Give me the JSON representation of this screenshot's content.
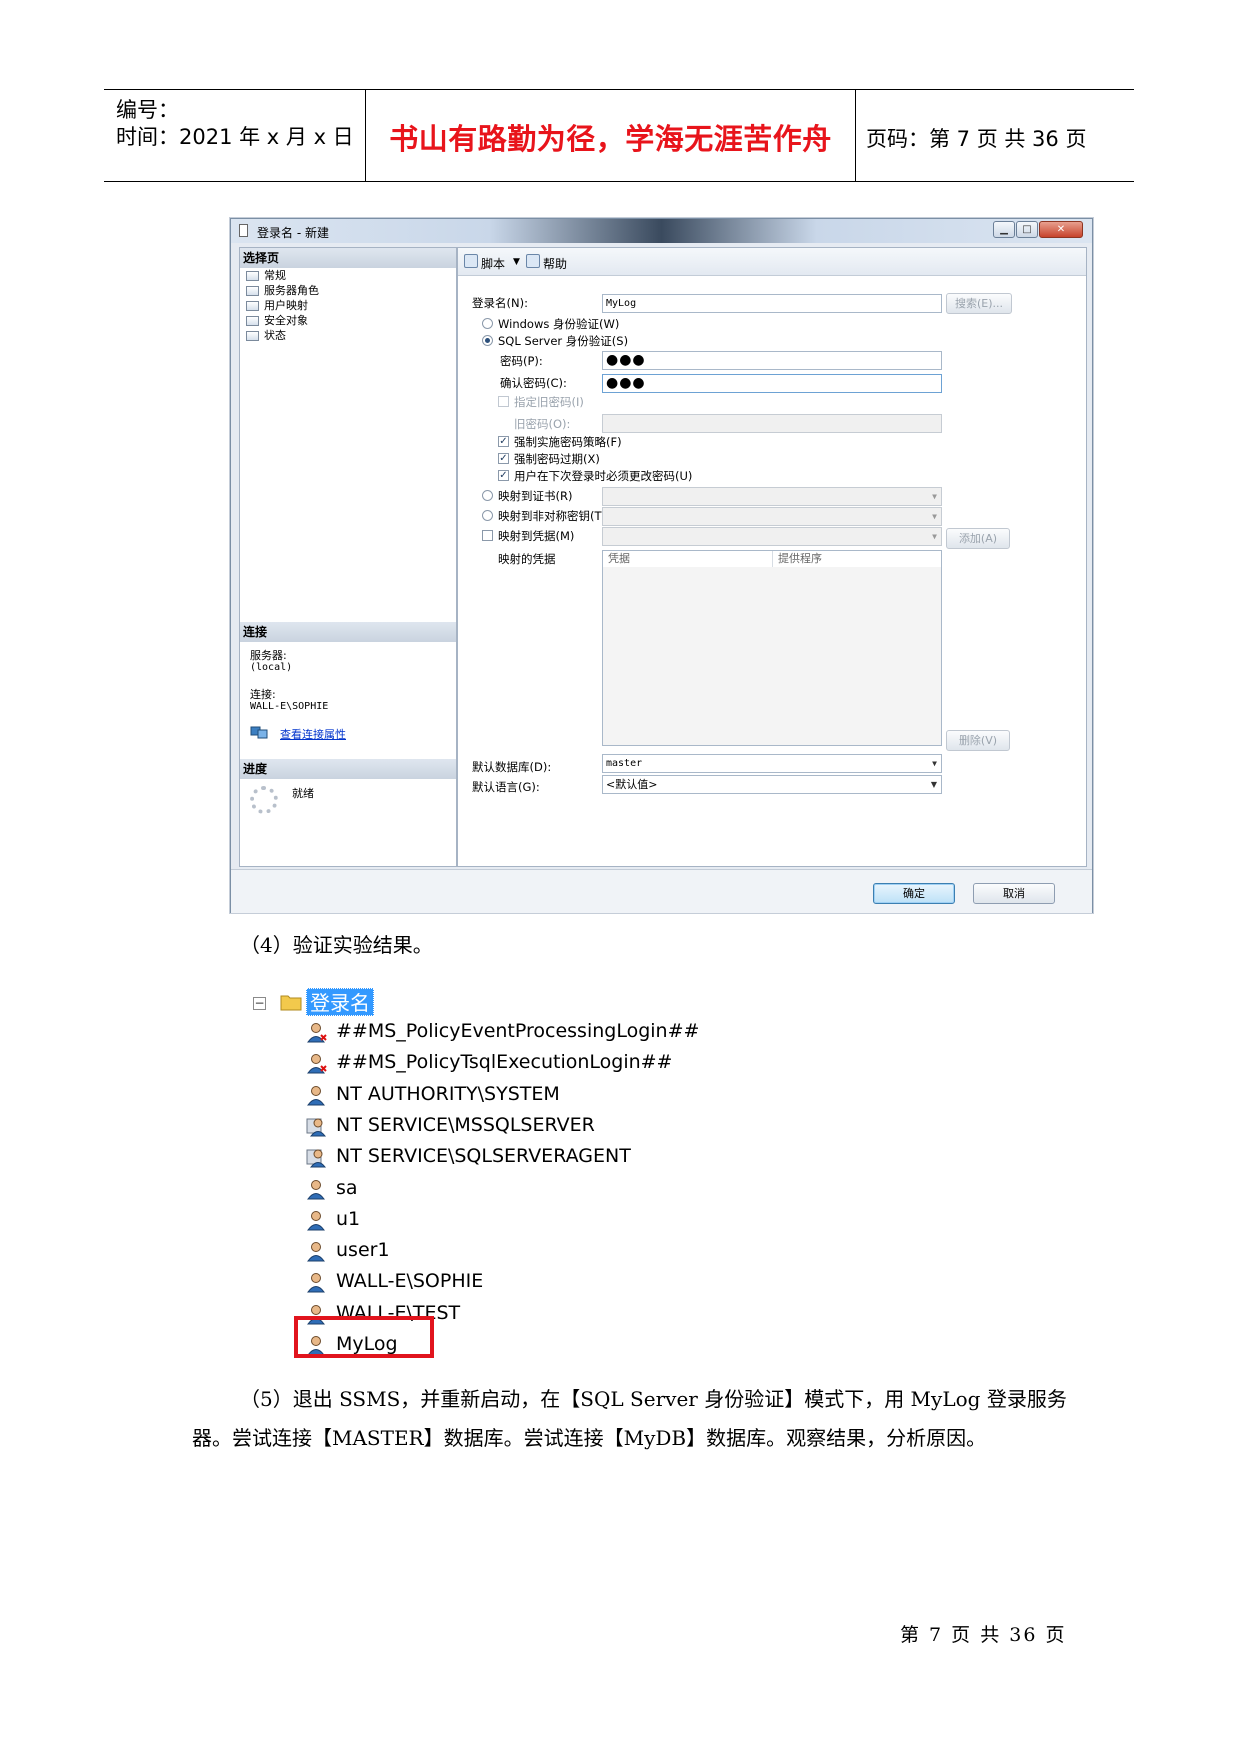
{
  "header": {
    "number_label": "编号：",
    "time_label": "时间：2021 年 x 月 x 日",
    "motto": "书山有路勤为径，学海无涯苦作舟",
    "page_info": "页码：第 7 页  共 36 页"
  },
  "dialog": {
    "title": "登录名 - 新建",
    "left": {
      "select_page_header": "选择页",
      "nav": [
        "常规",
        "服务器角色",
        "用户映射",
        "安全对象",
        "状态"
      ],
      "connection_header": "连接",
      "server_label": "服务器:",
      "server_value": "(local)",
      "connection_label": "连接:",
      "connection_value": "WALL-E\\SOPHIE",
      "view_props_link": "查看连接属性",
      "progress_header": "进度",
      "progress_status": "就绪"
    },
    "toolbar": {
      "script": "脚本",
      "help": "帮助"
    },
    "form": {
      "login_name_label": "登录名(N):",
      "login_name_value": "MyLog",
      "search_button": "搜索(E)...",
      "windows_auth": "Windows 身份验证(W)",
      "sql_auth": "SQL Server 身份验证(S)",
      "password_label": "密码(P):",
      "password_value": "●●●",
      "confirm_label": "确认密码(C):",
      "confirm_value": "●●●",
      "old_pwd_check": "指定旧密码(I)",
      "old_pwd_label": "旧密码(O):",
      "enforce_policy": "强制实施密码策略(F)",
      "enforce_expiry": "强制密码过期(X)",
      "must_change": "用户在下次登录时必须更改密码(U)",
      "map_cert": "映射到证书(R)",
      "map_asym": "映射到非对称密钥(T)",
      "map_cred": "映射到凭据(M)",
      "add_button": "添加(A)",
      "mapped_creds_label": "映射的凭据",
      "grid_cols": [
        "凭据",
        "提供程序"
      ],
      "remove_button": "删除(V)",
      "default_db_label": "默认数据库(D):",
      "default_db_value": "master",
      "default_lang_label": "默认语言(G):",
      "default_lang_value": "<默认值>"
    },
    "buttons": {
      "ok": "确定",
      "cancel": "取消"
    }
  },
  "step4": "（4）验证实验结果。",
  "tree": {
    "root": "登录名",
    "items": [
      "##MS_PolicyEventProcessingLogin##",
      "##MS_PolicyTsqlExecutionLogin##",
      "NT AUTHORITY\\SYSTEM",
      "NT SERVICE\\MSSQLSERVER",
      "NT SERVICE\\SQLSERVERAGENT",
      "sa",
      "u1",
      "user1",
      "WALL-E\\SOPHIE",
      "WALL-E\\TEST",
      "MyLog"
    ]
  },
  "step5_line1": "（5）退出 SSMS，并重新启动，在【SQL Server 身份验证】模式下，用 MyLog 登录服务",
  "step5_line2": "器。尝试连接【MASTER】数据库。尝试连接【MyDB】数据库。观察结果，分析原因。",
  "footer": "第 7 页 共 36 页"
}
